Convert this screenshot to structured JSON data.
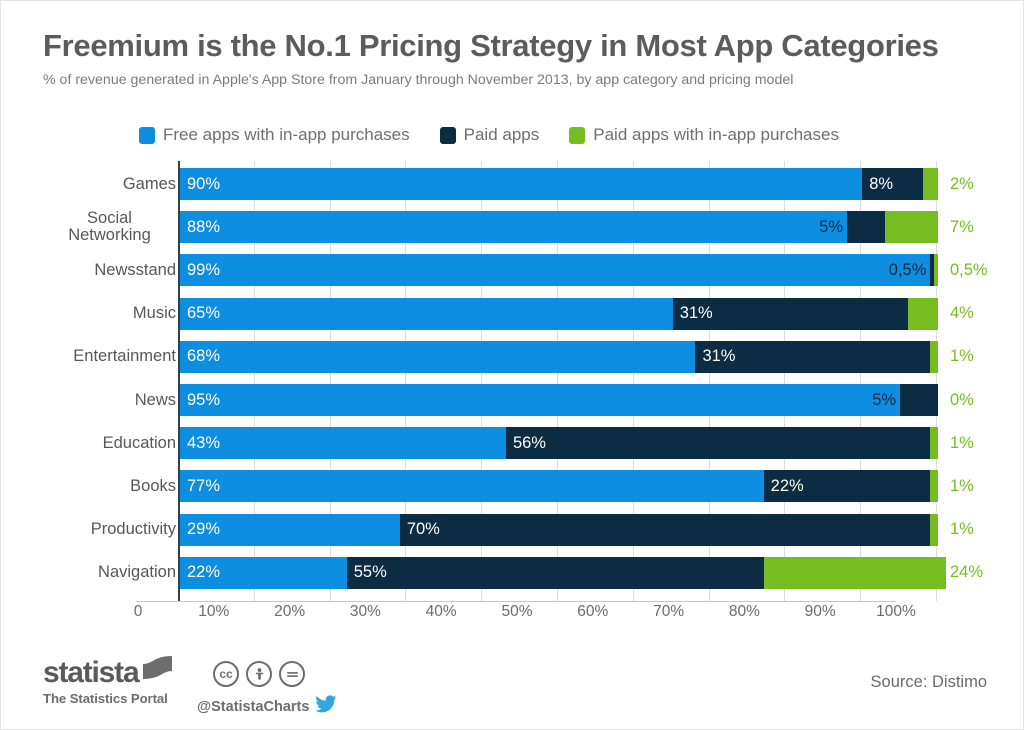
{
  "header": {
    "title": "Freemium is the No.1 Pricing Strategy in Most App Categories",
    "subtitle": "% of revenue generated in Apple's App Store from January through November 2013, by app category and pricing model"
  },
  "colors": {
    "free_inapp": "#0d8ee0",
    "paid": "#0b2c42",
    "paid_inapp": "#76bd22",
    "title": "#5c5c5c",
    "subtitle": "#7b7b7b",
    "axis": "#31414d",
    "grid": "#dcdcdc"
  },
  "legend": [
    {
      "label": "Free apps with in-app purchases",
      "color": "#0d8ee0",
      "key": "free_inapp"
    },
    {
      "label": "Paid apps",
      "color": "#0b2c42",
      "key": "paid"
    },
    {
      "label": "Paid apps with in-app purchases",
      "color": "#76bd22",
      "key": "paid_inapp"
    }
  ],
  "axis": {
    "ticks": [
      "0",
      "10%",
      "20%",
      "30%",
      "40%",
      "50%",
      "60%",
      "70%",
      "80%",
      "90%",
      "100%"
    ],
    "tick_values": [
      0,
      10,
      20,
      30,
      40,
      50,
      60,
      70,
      80,
      90,
      100
    ]
  },
  "footer": {
    "brand": "statista",
    "brand_sub": "The Statistics Portal",
    "cc_glyphs": [
      "cc",
      "by",
      "nd"
    ],
    "handle": "@StatistaCharts",
    "source": "Source: Distimo"
  },
  "chart_data": {
    "type": "bar",
    "orientation": "horizontal",
    "stacked": true,
    "stacked_percent": true,
    "title": "Freemium is the No.1 Pricing Strategy in Most App Categories",
    "subtitle": "% of revenue generated in Apple's App Store from January through November 2013, by app category and pricing model",
    "xlabel": "",
    "ylabel": "",
    "xlim": [
      0,
      100
    ],
    "grid": true,
    "legend_position": "top",
    "categories": [
      "Games",
      "Social Networking",
      "Newsstand",
      "Music",
      "Entertainment",
      "News",
      "Education",
      "Books",
      "Productivity",
      "Navigation"
    ],
    "series": [
      {
        "name": "Free apps with in-app purchases",
        "color": "#0d8ee0",
        "values": [
          90,
          88,
          99,
          65,
          68,
          95,
          43,
          77,
          29,
          22
        ],
        "labels": [
          "90%",
          "88%",
          "99%",
          "65%",
          "68%",
          "95%",
          "43%",
          "77%",
          "29%",
          "22%"
        ]
      },
      {
        "name": "Paid apps",
        "color": "#0b2c42",
        "values": [
          8,
          5,
          0.5,
          31,
          31,
          5,
          56,
          22,
          70,
          55
        ],
        "labels": [
          "8%",
          "5%",
          "0,5%",
          "31%",
          "31%",
          "5%",
          "56%",
          "22%",
          "70%",
          "55%"
        ]
      },
      {
        "name": "Paid apps with in-app purchases",
        "color": "#76bd22",
        "values": [
          2,
          7,
          0.5,
          4,
          1,
          0,
          1,
          1,
          1,
          24
        ],
        "labels": [
          "2%",
          "7%",
          "0,5%",
          "4%",
          "1%",
          "0%",
          "1%",
          "1%",
          "1%",
          "24%"
        ]
      }
    ]
  }
}
